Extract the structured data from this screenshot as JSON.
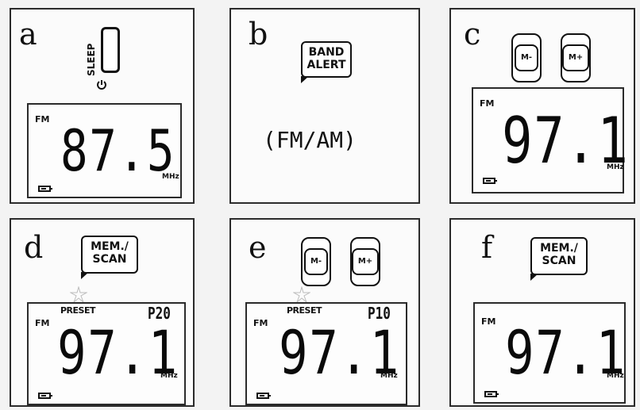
{
  "panels": {
    "a": {
      "letter": "a",
      "button_label": "SLEEP",
      "band": "FM",
      "frequency": "87.5",
      "unit": "MHz"
    },
    "b": {
      "letter": "b",
      "button_line1": "BAND",
      "button_line2": "ALERT",
      "mode_text": "(FM/AM)"
    },
    "c": {
      "letter": "c",
      "button_minus": "M-",
      "button_plus": "M+",
      "band": "FM",
      "frequency": "97.1",
      "unit": "MHz"
    },
    "d": {
      "letter": "d",
      "button_line1": "MEM./",
      "button_line2": "SCAN",
      "preset_label": "PRESET",
      "preset_number": "P20",
      "band": "FM",
      "frequency": "97.1",
      "unit": "MHz"
    },
    "e": {
      "letter": "e",
      "button_minus": "M-",
      "button_plus": "M+",
      "preset_label": "PRESET",
      "preset_number": "P10",
      "band": "FM",
      "frequency": "97.1",
      "unit": "MHz"
    },
    "f": {
      "letter": "f",
      "button_line1": "MEM./",
      "button_line2": "SCAN",
      "band": "FM",
      "frequency": "97.1",
      "unit": "MHz"
    }
  }
}
